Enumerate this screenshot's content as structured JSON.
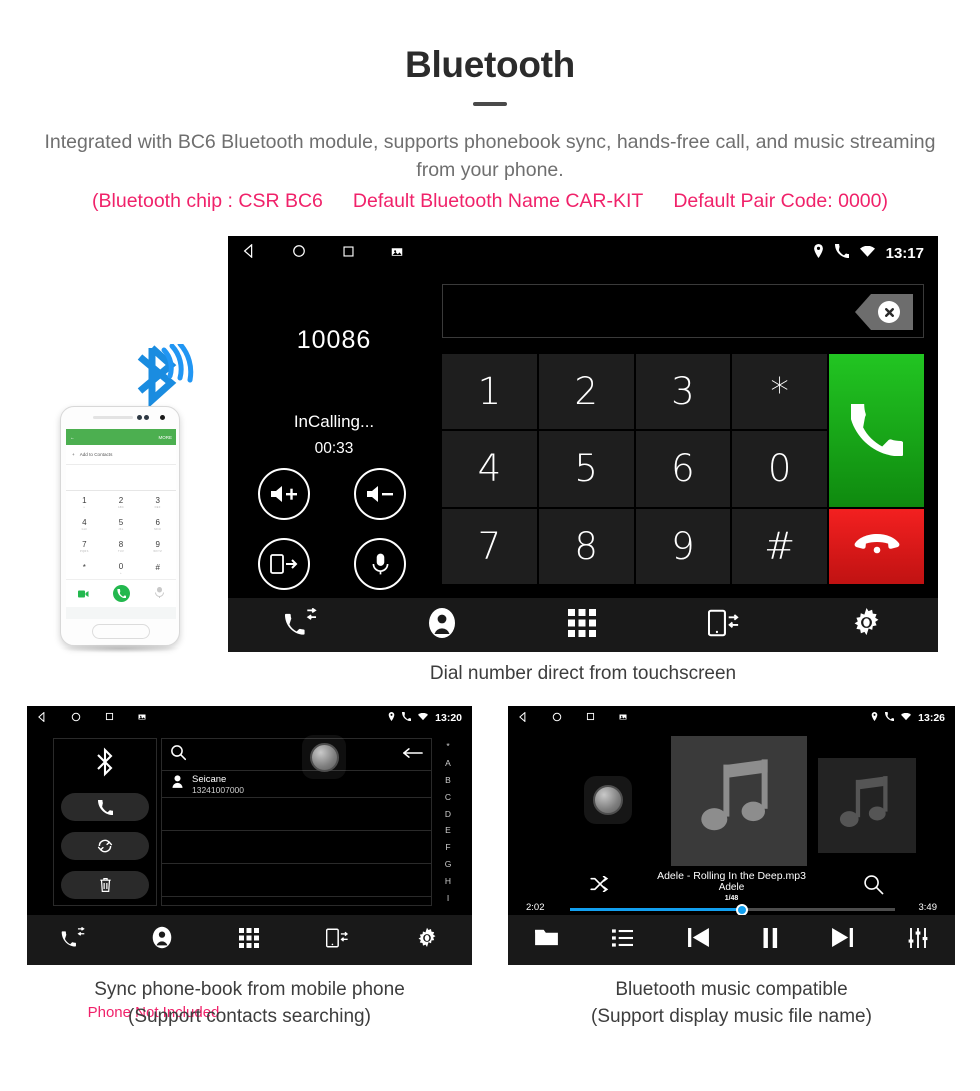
{
  "header": {
    "title": "Bluetooth",
    "subtitle": "Integrated with BC6 Bluetooth module, supports phonebook sync, hands-free call, and music streaming from your phone.",
    "spec_chip": "(Bluetooth chip : CSR BC6",
    "spec_name": "Default Bluetooth Name CAR-KIT",
    "spec_pair": "Default Pair Code: 0000)",
    "accent_color": "#f0226a",
    "text_color": "#6f6f6f"
  },
  "phone_mock": {
    "disclaimer": "Phone Not Included",
    "screen": {
      "back_arrow": "←",
      "more_label": "MORE",
      "add_contact_label": "Add to Contacts",
      "plus": "+",
      "keys": [
        {
          "digit": "1",
          "sub": "∞"
        },
        {
          "digit": "2",
          "sub": "ABC"
        },
        {
          "digit": "3",
          "sub": "DEF"
        },
        {
          "digit": "4",
          "sub": "GHI"
        },
        {
          "digit": "5",
          "sub": "JKL"
        },
        {
          "digit": "6",
          "sub": "MNO"
        },
        {
          "digit": "7",
          "sub": "PQRS"
        },
        {
          "digit": "8",
          "sub": "TUV"
        },
        {
          "digit": "9",
          "sub": "WXYZ"
        },
        {
          "digit": "*",
          "sub": ""
        },
        {
          "digit": "0",
          "sub": "+"
        },
        {
          "digit": "#",
          "sub": ""
        }
      ]
    }
  },
  "dialer": {
    "statusbar": {
      "time": "13:17",
      "icons_left": [
        "back-icon",
        "home-icon",
        "recents-icon",
        "screenshot-icon"
      ],
      "icons_right": [
        "location-icon",
        "phone-icon",
        "wifi-icon"
      ]
    },
    "caller_number": "10086",
    "call_state": "InCalling...",
    "call_timer": "00:33",
    "controls": [
      "volume-up",
      "volume-down",
      "transfer-audio",
      "mute-mic"
    ],
    "input_value": "",
    "keys": [
      "1",
      "2",
      "3",
      "*",
      "4",
      "5",
      "6",
      "0",
      "7",
      "8",
      "9",
      "#"
    ],
    "call_button": "call-icon",
    "end_button": "end-call-icon",
    "nav": [
      "call-log-icon",
      "contacts-icon",
      "keypad-icon",
      "transfer-icon",
      "settings-icon"
    ],
    "caption": "Dial number direct from touchscreen"
  },
  "phonebook": {
    "statusbar": {
      "time": "13:20"
    },
    "side_actions": [
      "bluetooth-icon",
      "dial-icon",
      "sync-icon",
      "delete-icon"
    ],
    "search_value": "",
    "contacts": [
      {
        "name": "Seicane",
        "number": "13241007000"
      },
      {
        "name": "",
        "number": ""
      },
      {
        "name": "",
        "number": ""
      },
      {
        "name": "",
        "number": ""
      },
      {
        "name": "",
        "number": ""
      }
    ],
    "index_letters": [
      "*",
      "A",
      "B",
      "C",
      "D",
      "E",
      "F",
      "G",
      "H",
      "I"
    ],
    "nav": [
      "call-log-icon",
      "contacts-icon",
      "keypad-icon",
      "transfer-icon",
      "settings-icon"
    ],
    "caption_line1": "Sync phone-book from mobile phone",
    "caption_line2": "(Support contacts searching)"
  },
  "music": {
    "statusbar": {
      "time": "13:26"
    },
    "track_title": "Adele - Rolling In the Deep.mp3",
    "artist": "Adele",
    "track_count": "1/48",
    "elapsed": "2:02",
    "total": "3:49",
    "progress_percent": 53,
    "shuffle": "shuffle-icon",
    "search": "search-icon",
    "nav": [
      "folder-icon",
      "playlist-icon",
      "previous-icon",
      "pause-icon",
      "next-icon",
      "equalizer-icon"
    ],
    "caption_line1": "Bluetooth music compatible",
    "caption_line2": "(Support display music file name)",
    "accent_color": "#12a0f0"
  }
}
